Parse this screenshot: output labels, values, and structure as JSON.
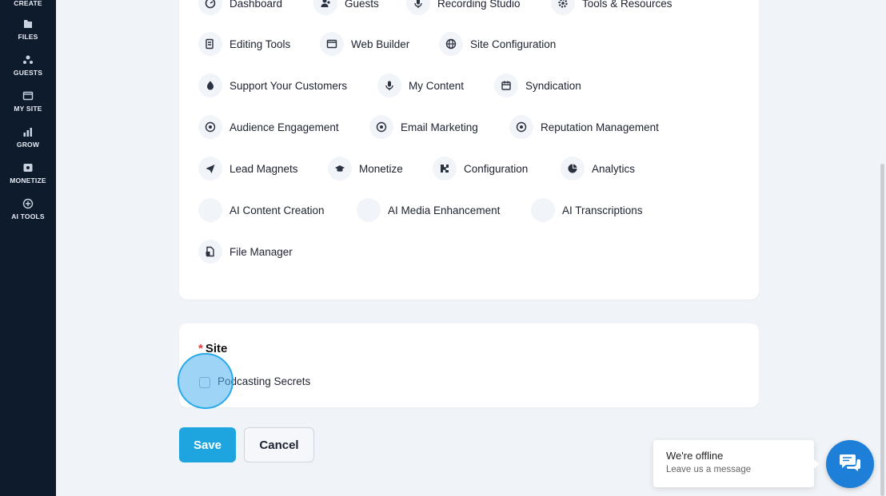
{
  "sidebar": {
    "items": [
      {
        "label": "CREATE",
        "icon": "create-icon"
      },
      {
        "label": "FILES",
        "icon": "files-icon"
      },
      {
        "label": "GUESTS",
        "icon": "guests-icon"
      },
      {
        "label": "MY SITE",
        "icon": "my-site-icon"
      },
      {
        "label": "GROW",
        "icon": "grow-icon"
      },
      {
        "label": "MONETIZE",
        "icon": "monetize-icon"
      },
      {
        "label": "AI TOOLS",
        "icon": "ai-tools-icon"
      }
    ]
  },
  "permissions": {
    "items": [
      {
        "label": "Dashboard",
        "icon": "dashboard-icon"
      },
      {
        "label": "Guests",
        "icon": "guests-icon"
      },
      {
        "label": "Recording Studio",
        "icon": "microphone-icon"
      },
      {
        "label": "Tools & Resources",
        "icon": "gear-icon"
      },
      {
        "label": "Editing Tools",
        "icon": "editing-icon"
      },
      {
        "label": "Web Builder",
        "icon": "web-builder-icon"
      },
      {
        "label": "Site Configuration",
        "icon": "globe-icon"
      },
      {
        "label": "Support Your Customers",
        "icon": "support-icon"
      },
      {
        "label": "My Content",
        "icon": "microphone-icon"
      },
      {
        "label": "Syndication",
        "icon": "calendar-icon"
      },
      {
        "label": "Audience Engagement",
        "icon": "engagement-icon"
      },
      {
        "label": "Email Marketing",
        "icon": "engagement-icon"
      },
      {
        "label": "Reputation Management",
        "icon": "engagement-icon"
      },
      {
        "label": "Lead Magnets",
        "icon": "paper-plane-icon"
      },
      {
        "label": "Monetize",
        "icon": "graduation-cap-icon"
      },
      {
        "label": "Configuration",
        "icon": "puzzle-icon"
      },
      {
        "label": "Analytics",
        "icon": "pie-chart-icon"
      },
      {
        "label": "AI Content Creation",
        "icon": "blank-icon"
      },
      {
        "label": "AI Media Enhancement",
        "icon": "blank-icon"
      },
      {
        "label": "AI Transcriptions",
        "icon": "blank-icon"
      },
      {
        "label": "File Manager",
        "icon": "file-manager-icon"
      }
    ]
  },
  "site": {
    "required_mark": "*",
    "title": "Site",
    "options": [
      {
        "label": "Podcasting Secrets",
        "checked": false
      }
    ]
  },
  "actions": {
    "save_label": "Save",
    "cancel_label": "Cancel"
  },
  "chat": {
    "title": "We're offline",
    "subtitle": "Leave us a message"
  },
  "colors": {
    "sidebar": "#0e1b2c",
    "primary": "#1ea5e0",
    "chat": "#1e7fd8",
    "required": "#e53935"
  }
}
